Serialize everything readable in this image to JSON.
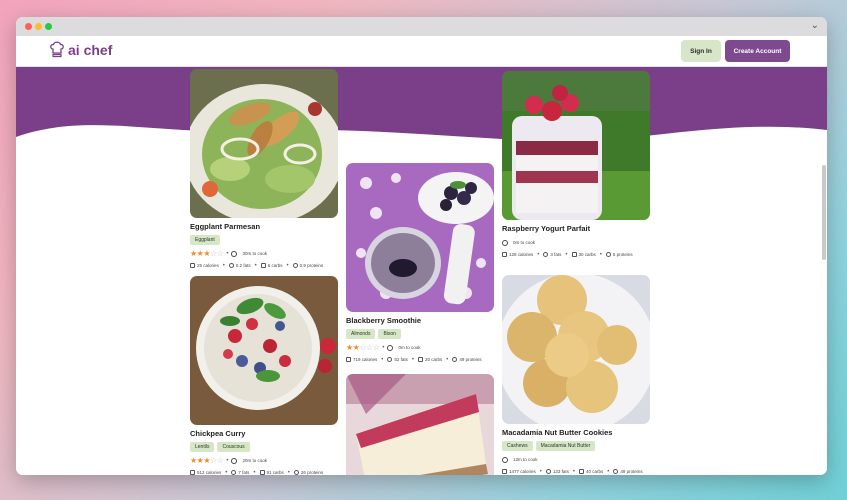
{
  "app": {
    "name": "ai chef"
  },
  "nav": {
    "signin": "Sign In",
    "create": "Create Account"
  },
  "colors": {
    "brand_purple": "#7b3f8a",
    "tag_green": "#d5e7c7",
    "star_orange": "#f08a24"
  },
  "recipes": [
    {
      "title": "Eggplant Parmesan",
      "tags": [
        "Eggplant"
      ],
      "rating": 3,
      "cook_time": "30m to cook",
      "calories": "25 calories",
      "fats": "0.2 fats",
      "carbs": "6 carbs",
      "proteins": "0.9 proteins"
    },
    {
      "title": "Chickpea Curry",
      "tags": [
        "Lentils",
        "Couscous"
      ],
      "rating": 3,
      "cook_time": "20m to cook",
      "calories": "512 calories",
      "fats": "7 fats",
      "carbs": "91 carbs",
      "proteins": "26 proteins"
    },
    {
      "title": "Blackberry Smoothie",
      "tags": [
        "Almonds",
        "Bison"
      ],
      "rating": 2,
      "cook_time": "0m to cook",
      "calories": "719 calories",
      "fats": "52 fats",
      "carbs": "20 carbs",
      "proteins": "49 proteins"
    },
    {
      "title": "Raspberry Yogurt Parfait",
      "tags": [],
      "rating": 0,
      "cook_time": "0m to cook",
      "calories": "128 calories",
      "fats": "3 fats",
      "carbs": "30 carbs",
      "proteins": "5 proteins"
    },
    {
      "title": "Macadamia Nut Butter Cookies",
      "tags": [
        "Cashews",
        "Macadamia Nut Butter"
      ],
      "rating": 0,
      "cook_time": "13m to cook",
      "calories": "1477 calories",
      "fats": "133 fats",
      "carbs": "40 carbs",
      "proteins": "49 proteins"
    }
  ]
}
